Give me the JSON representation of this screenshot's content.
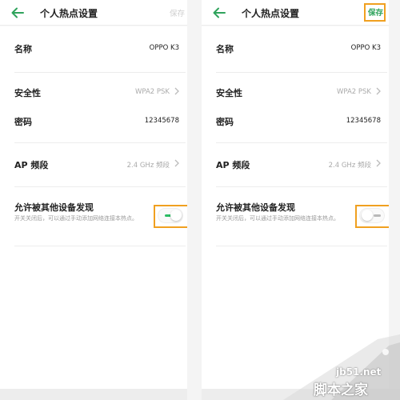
{
  "screens": [
    {
      "title": "个人热点设置",
      "save_label": "保存",
      "save_state": "disabled",
      "rows": {
        "name": {
          "label": "名称",
          "value": "OPPO K3"
        },
        "security": {
          "label": "安全性",
          "value": "WPA2 PSK"
        },
        "password": {
          "label": "密码",
          "value": "12345678"
        },
        "band": {
          "label": "AP 频段",
          "value": "2.4 GHz 频段"
        },
        "discover": {
          "label": "允许被其他设备发现",
          "description": "开关关闭后，可以通过手动添加网络连接本热点。",
          "toggle_on": true
        }
      }
    },
    {
      "title": "个人热点设置",
      "save_label": "保存",
      "save_state": "active",
      "rows": {
        "name": {
          "label": "名称",
          "value": "OPPO K3"
        },
        "security": {
          "label": "安全性",
          "value": "WPA2 PSK"
        },
        "password": {
          "label": "密码",
          "value": "12345678"
        },
        "band": {
          "label": "AP 频段",
          "value": "2.4 GHz 频段"
        },
        "discover": {
          "label": "允许被其他设备发现",
          "description": "开关关闭后，可以通过手动添加网络连接本热点。",
          "toggle_on": false
        }
      }
    }
  ],
  "watermark": {
    "url": "jb51.net",
    "name": "脚本之家"
  },
  "colors": {
    "accent": "#2fa35c",
    "toggle_on": "#2bbd63",
    "highlight": "#f0a020"
  },
  "icons": [
    "back-arrow-icon",
    "chevron-right-icon"
  ]
}
